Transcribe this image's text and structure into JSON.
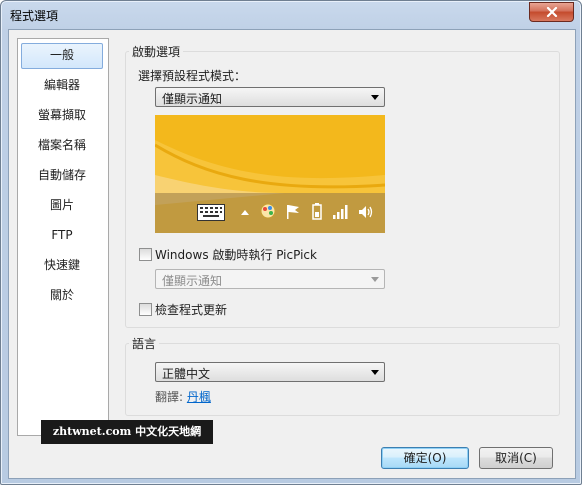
{
  "window": {
    "title": "程式選項"
  },
  "sidebar": {
    "items": [
      {
        "label": "一般",
        "active": true
      },
      {
        "label": "編輯器"
      },
      {
        "label": "螢幕擷取"
      },
      {
        "label": "檔案名稱"
      },
      {
        "label": "自動儲存"
      },
      {
        "label": "圖片"
      },
      {
        "label": "FTP"
      },
      {
        "label": "快速鍵"
      },
      {
        "label": "關於"
      }
    ]
  },
  "startup": {
    "legend": "啟動選項",
    "mode_label": "選擇預設程式模式：",
    "mode_value": "僅顯示通知",
    "windows_startup_label": "Windows 啟動時執行 PicPick",
    "windows_startup_checked": false,
    "startup_mode_value": "僅顯示通知",
    "check_update_label": "檢查程式更新",
    "check_update_checked": false
  },
  "language": {
    "legend": "語言",
    "value": "正體中文",
    "translator_label": "翻譯: ",
    "translator_link": "丹楓"
  },
  "watermark": "zhtwnet.com 中文化天地網",
  "buttons": {
    "ok": "確定(O)",
    "cancel": "取消(C)"
  },
  "colors": {
    "accent": "#84acdd",
    "preview_bg": "#f3b81c",
    "link": "#0066cc"
  },
  "tray_icons": [
    "keyboard-icon",
    "chevron-up-icon",
    "picpick-icon",
    "flag-icon",
    "battery-icon",
    "signal-icon",
    "speaker-icon"
  ]
}
